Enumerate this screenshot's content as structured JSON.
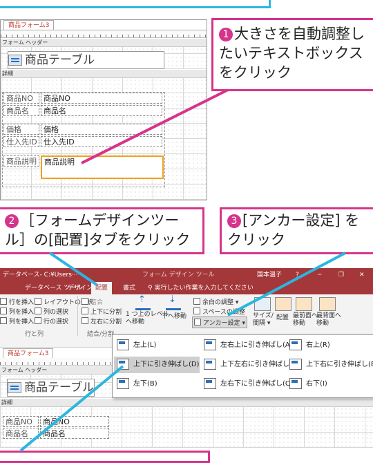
{
  "accent": "#d6348c",
  "access_red": "#a4373a",
  "shot1": {
    "tab": "商品フォーム3",
    "header_section": "フォーム ヘッダー",
    "title": "商品テーブル",
    "detail_section": "詳細",
    "fields": [
      {
        "label": "商品NO",
        "value": "商品NO"
      },
      {
        "label": "商品名",
        "value": "商品名"
      },
      {
        "label": "価格",
        "value": "価格"
      },
      {
        "label": "仕入先ID",
        "value": "仕入先ID"
      },
      {
        "label": "商品説明",
        "value": "商品説明"
      }
    ]
  },
  "callouts": {
    "c1_num": "❶",
    "c1_text": "大きさを自動調整したいテキストボックスをクリック",
    "c2_text": "［フォームデザインツール］の[配置]タブをクリック",
    "c3_num": "❸",
    "c3_text": "[アンカー設定] をクリック"
  },
  "shot2": {
    "title_left": "データベース- C:¥Users···",
    "title_center": "フォーム デザイン ツール",
    "title_user": "国本温子",
    "title_help": "?",
    "tabs": [
      "データベース ツール",
      "デザイン",
      "配置",
      "書式"
    ],
    "tell_me": "実行したい作業を入力してください",
    "group1": [
      "行を挿入",
      "列を挿入",
      "列を挿入"
    ],
    "group1b": [
      "レイアウトの選択",
      "列の選択",
      "行の選択"
    ],
    "group1_label": "行と列",
    "merge": [
      "結合",
      "上下に分割",
      "左右に分割"
    ],
    "merge_label": "結合/分割",
    "move_up": "1 つ上のレベル\nへ移動",
    "move_down": "下へ移動",
    "margins": "余白の調整 ▾",
    "spacing": "スペースの調整",
    "anchor": "アンカー設定 ▾",
    "size": "サイズ/\n間隔 ▾",
    "align": "配置",
    "front": "最前面へ\n移動",
    "back": "最背面へ\n移動",
    "tab": "商品フォーム3",
    "header_section": "フォーム ヘッダー",
    "title": "商品テーブル",
    "detail_section": "詳細",
    "fields": [
      {
        "label": "商品NO",
        "value": "商品NO"
      },
      {
        "label": "商品名",
        "value": "商品名"
      }
    ],
    "anchor_menu": [
      [
        "左上(L)",
        "左右上に引き伸ばし(A)",
        "右上(R)"
      ],
      [
        "上下に引き伸ばし(D)",
        "上下左右に引き伸ばし(S)",
        "上下右に引き伸ばし(E)"
      ],
      [
        "左下(B)",
        "左右下に引き伸ばし(C)",
        "右下(I)"
      ]
    ]
  }
}
